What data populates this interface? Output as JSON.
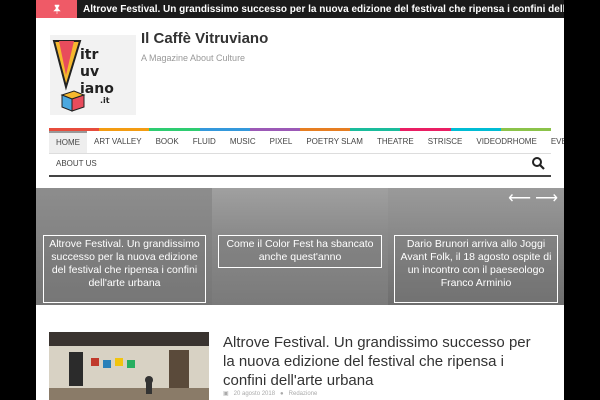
{
  "ticker": {
    "badge_icon": "thumbtack-icon",
    "text": "Altrove Festival. Un grandissimo successo per la nuova edizione del festival che ripensa i confini dell'arte urbana"
  },
  "site": {
    "logo_text": "Vitruviano.it",
    "title": "Il Caffè Vitruviano",
    "tagline": "A Magazine About Culture"
  },
  "nav": {
    "items": [
      "Home",
      "Art Valley",
      "Book",
      "Fluid",
      "Music",
      "Pixel",
      "Poetry Slam",
      "Theatre",
      "Strisce",
      "VideoDRHome",
      "Eventi"
    ],
    "items_row2": [
      "About Us"
    ],
    "active": "Home",
    "strip_colors": [
      "#e74c3c",
      "#f39c12",
      "#2ecc71",
      "#3498db",
      "#9b59b6",
      "#e67e22",
      "#1abc9c",
      "#e91e63",
      "#00bcd4",
      "#8bc34a"
    ]
  },
  "slider": {
    "slides": [
      {
        "caption": "Altrove Festival. Un grandissimo successo per la nuova edizione del festival che ripensa i confini dell'arte urbana"
      },
      {
        "caption": "Come il Color Fest ha sbancato anche quest'anno"
      },
      {
        "caption": "Dario Brunori arriva allo Joggi Avant Folk, il 18 agosto ospite di un incontro con il paeseologo Franco Arminio"
      }
    ],
    "prev_icon": "arrow-left-icon",
    "next_icon": "arrow-right-icon"
  },
  "post": {
    "title": "Altrove Festival. Un grandissimo successo per la nuova edizione del festival che ripensa i confini dell'arte urbana",
    "date": "20 agosto 2018",
    "author": "Redazione"
  }
}
